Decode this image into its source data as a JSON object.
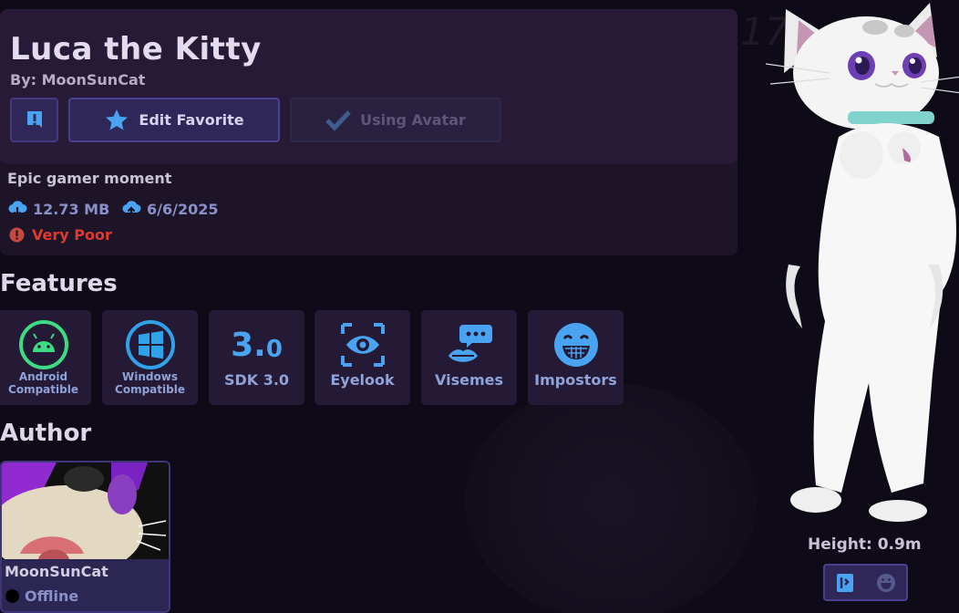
{
  "avatar": {
    "name": "Luca the Kitty",
    "author_line": "By: MoonSunCat",
    "description": "Epic gamer moment",
    "file_size": "12.73 MB",
    "updated": "6/6/2025",
    "performance": "Very Poor"
  },
  "actions": {
    "edit_favorite": "Edit Favorite",
    "using_avatar": "Using Avatar"
  },
  "sections": {
    "features": "Features",
    "author": "Author"
  },
  "features": [
    {
      "line1": "Android",
      "line2": "Compatible",
      "icon": "android-icon"
    },
    {
      "line1": "Windows",
      "line2": "Compatible",
      "icon": "windows-icon"
    },
    {
      "label": "SDK 3.0",
      "glyph_main": "3.",
      "glyph_sub": "0",
      "icon": "sdk-icon"
    },
    {
      "label": "Eyelook",
      "icon": "eye-icon"
    },
    {
      "label": "Visemes",
      "icon": "mouth-icon"
    },
    {
      "label": "Impostors",
      "icon": "grin-face-icon"
    }
  ],
  "author": {
    "name": "MoonSunCat",
    "status": "Offline"
  },
  "preview": {
    "height_label": "Height: 0.9m"
  },
  "background": {
    "digits": "17"
  },
  "colors": {
    "accent": "#4aa3f0",
    "android_green": "#3ddc84",
    "danger": "#e0392d",
    "panel": "#261a37"
  }
}
